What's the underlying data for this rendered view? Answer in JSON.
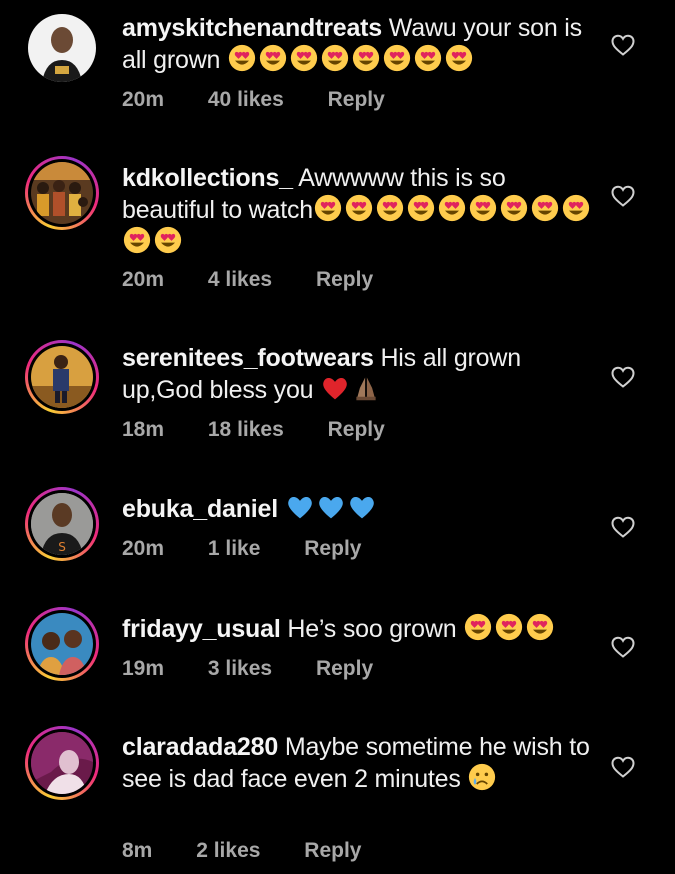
{
  "comments": [
    {
      "username": "amyskitchenandtreats",
      "text": "Wawu your son is all grown",
      "emoji": "😍😍😍😍😍😍😍😍",
      "time": "20m",
      "likes": "40 likes",
      "reply": "Reply"
    },
    {
      "username": "kdkollections_",
      "text": "Awwwww this is so beautiful to watch",
      "emoji": "😍😍😍😍😍😍😍😍😍😍😍",
      "time": "20m",
      "likes": "4 likes",
      "reply": "Reply"
    },
    {
      "username": "serenitees_footwears",
      "text": "His all grown up,God bless you",
      "emoji": "❤️🙏🏽",
      "time": "18m",
      "likes": "18 likes",
      "reply": "Reply"
    },
    {
      "username": "ebuka_daniel",
      "text": "",
      "emoji": "💙💙💙",
      "time": "20m",
      "likes": "1 like",
      "reply": "Reply"
    },
    {
      "username": "fridayy_usual",
      "text": "He’s soo grown",
      "emoji": "😍😍😍",
      "time": "19m",
      "likes": "3 likes",
      "reply": "Reply"
    },
    {
      "username": "claradada280",
      "text": "Maybe sometime he wish to see is dad face even 2 minutes",
      "emoji": "😢",
      "time": "8m",
      "likes": "2 likes",
      "reply": "Reply"
    }
  ],
  "colors": {
    "background": "#000000",
    "text": "#f5f5f5",
    "meta": "#a8a8a8",
    "heart_outline": "#d0d0d0",
    "story_ring": "#ee2a7b"
  },
  "icons": {
    "like": "heart-outline-icon",
    "heart_eyes": "heart-eyes-emoji",
    "red_heart": "red-heart-emoji",
    "blue_heart": "blue-heart-emoji",
    "pray": "folded-hands-emoji",
    "cry": "crying-face-emoji"
  }
}
